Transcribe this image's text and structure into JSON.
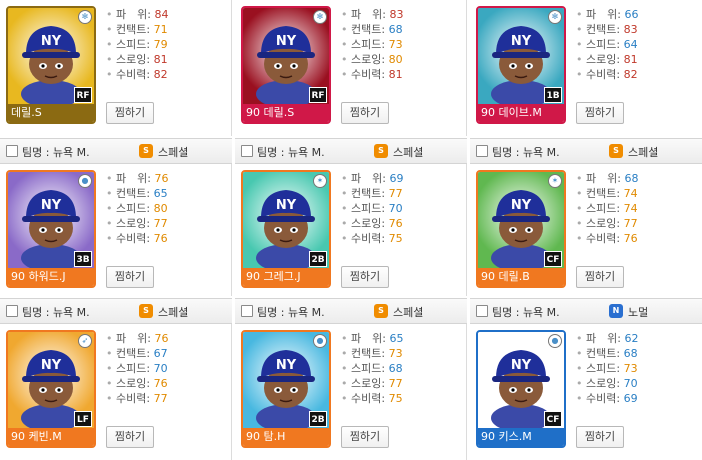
{
  "colors": {
    "stat_high": "#c0392b",
    "stat_mid": "#e08a00",
    "stat_low": "#2a7fc4"
  },
  "stat_labels": [
    "파　위",
    "컨택트",
    "스피드",
    "스로잉",
    "수비력"
  ],
  "cards": [
    {
      "has_header": false,
      "team": "",
      "grade": "",
      "grade_icon": "",
      "grade_color": "",
      "name": "데릴.S",
      "position": "RF",
      "name_bar": "#8b6a12",
      "bg": "#e8b820",
      "rank_icon": "snowflake-icon",
      "button": "찜하기",
      "stats": [
        {
          "v": "84",
          "c": "stat_high"
        },
        {
          "v": "71",
          "c": "stat_mid"
        },
        {
          "v": "79",
          "c": "stat_mid"
        },
        {
          "v": "81",
          "c": "stat_high"
        },
        {
          "v": "82",
          "c": "stat_high"
        }
      ]
    },
    {
      "has_header": false,
      "team": "",
      "grade": "",
      "grade_icon": "",
      "grade_color": "",
      "name": "90 데릴.S",
      "position": "RF",
      "name_bar": "#d01848",
      "bg": "#9a1020",
      "rank_icon": "snowflake-icon",
      "button": "찜하기",
      "stats": [
        {
          "v": "83",
          "c": "stat_high"
        },
        {
          "v": "68",
          "c": "stat_low"
        },
        {
          "v": "73",
          "c": "stat_mid"
        },
        {
          "v": "80",
          "c": "stat_mid"
        },
        {
          "v": "81",
          "c": "stat_high"
        }
      ]
    },
    {
      "has_header": false,
      "team": "",
      "grade": "",
      "grade_icon": "",
      "grade_color": "",
      "name": "90 데이브.M",
      "position": "1B",
      "name_bar": "#d01848",
      "bg": "#3aa8c0",
      "rank_icon": "snowflake-icon",
      "button": "찜하기",
      "stats": [
        {
          "v": "66",
          "c": "stat_low"
        },
        {
          "v": "83",
          "c": "stat_high"
        },
        {
          "v": "64",
          "c": "stat_low"
        },
        {
          "v": "81",
          "c": "stat_high"
        },
        {
          "v": "82",
          "c": "stat_high"
        }
      ]
    },
    {
      "has_header": true,
      "team": "팀명 : 뉴욕 M.",
      "grade": "스페셜",
      "grade_icon": "S",
      "grade_color": "#f08c00",
      "name": "90 하워드.J",
      "position": "3B",
      "name_bar": "#f07820",
      "bg": "#8a6ac8",
      "rank_icon": "ball-icon",
      "button": "찜하기",
      "stats": [
        {
          "v": "76",
          "c": "stat_mid"
        },
        {
          "v": "65",
          "c": "stat_low"
        },
        {
          "v": "80",
          "c": "stat_mid"
        },
        {
          "v": "77",
          "c": "stat_mid"
        },
        {
          "v": "76",
          "c": "stat_mid"
        }
      ]
    },
    {
      "has_header": true,
      "team": "팀명 : 뉴욕 M.",
      "grade": "스페셜",
      "grade_icon": "S",
      "grade_color": "#f08c00",
      "name": "90 그레그.J",
      "position": "2B",
      "name_bar": "#f07820",
      "bg": "#48c8b0",
      "rank_icon": "star-icon",
      "button": "찜하기",
      "stats": [
        {
          "v": "69",
          "c": "stat_low"
        },
        {
          "v": "77",
          "c": "stat_mid"
        },
        {
          "v": "70",
          "c": "stat_low"
        },
        {
          "v": "76",
          "c": "stat_mid"
        },
        {
          "v": "75",
          "c": "stat_mid"
        }
      ]
    },
    {
      "has_header": true,
      "team": "팀명 : 뉴욕 M.",
      "grade": "스페셜",
      "grade_icon": "S",
      "grade_color": "#f08c00",
      "name": "90 데릴.B",
      "position": "CF",
      "name_bar": "#f07820",
      "bg": "#60b850",
      "rank_icon": "star-icon",
      "button": "찜하기",
      "stats": [
        {
          "v": "68",
          "c": "stat_low"
        },
        {
          "v": "74",
          "c": "stat_mid"
        },
        {
          "v": "74",
          "c": "stat_mid"
        },
        {
          "v": "77",
          "c": "stat_mid"
        },
        {
          "v": "76",
          "c": "stat_mid"
        }
      ]
    },
    {
      "has_header": true,
      "team": "팀명 : 뉴욕 M.",
      "grade": "스페셜",
      "grade_icon": "S",
      "grade_color": "#f08c00",
      "name": "90 케빈.M",
      "position": "LF",
      "name_bar": "#f07820",
      "bg": "#f0a830",
      "rank_icon": "bird-icon",
      "button": "찜하기",
      "stats": [
        {
          "v": "76",
          "c": "stat_mid"
        },
        {
          "v": "67",
          "c": "stat_low"
        },
        {
          "v": "70",
          "c": "stat_low"
        },
        {
          "v": "76",
          "c": "stat_mid"
        },
        {
          "v": "77",
          "c": "stat_mid"
        }
      ]
    },
    {
      "has_header": true,
      "team": "팀명 : 뉴욕 M.",
      "grade": "스페셜",
      "grade_icon": "S",
      "grade_color": "#f08c00",
      "name": "90 탐.H",
      "position": "2B",
      "name_bar": "#f07820",
      "bg": "#48b8e0",
      "rank_icon": "ball-icon",
      "button": "찜하기",
      "stats": [
        {
          "v": "65",
          "c": "stat_low"
        },
        {
          "v": "73",
          "c": "stat_mid"
        },
        {
          "v": "68",
          "c": "stat_low"
        },
        {
          "v": "77",
          "c": "stat_mid"
        },
        {
          "v": "75",
          "c": "stat_mid"
        }
      ]
    },
    {
      "has_header": true,
      "team": "팀명 : 뉴욕 M.",
      "grade": "노멀",
      "grade_icon": "N",
      "grade_color": "#2a6fd0",
      "name": "90 키스.M",
      "position": "CF",
      "name_bar": "#1f6fc8",
      "bg": "#ffffff",
      "rank_icon": "ball-icon",
      "button": "찜하기",
      "stats": [
        {
          "v": "62",
          "c": "stat_low"
        },
        {
          "v": "68",
          "c": "stat_low"
        },
        {
          "v": "73",
          "c": "stat_mid"
        },
        {
          "v": "70",
          "c": "stat_low"
        },
        {
          "v": "69",
          "c": "stat_low"
        }
      ]
    }
  ]
}
